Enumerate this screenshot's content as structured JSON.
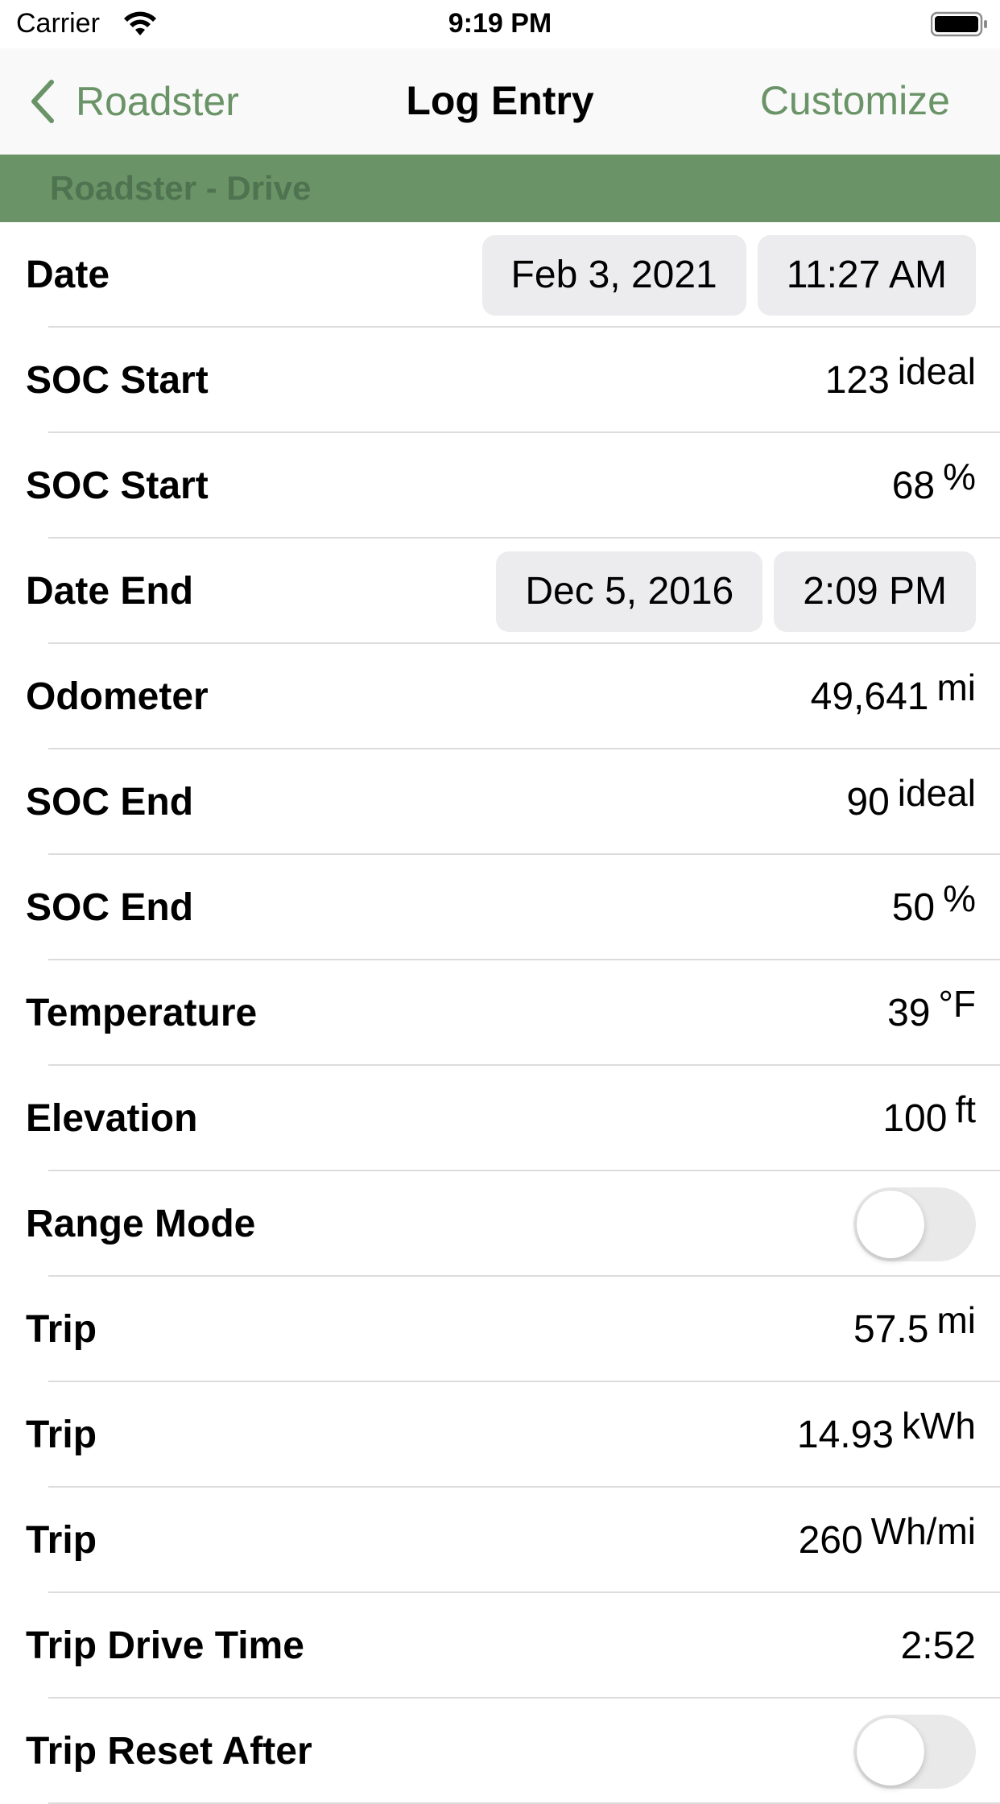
{
  "status_bar": {
    "carrier": "Carrier",
    "time": "9:19 PM",
    "icons": [
      "wifi-icon",
      "battery-icon"
    ]
  },
  "nav": {
    "back_label": "Roadster",
    "title": "Log Entry",
    "right_label": "Customize",
    "accent_color": "#6a9467"
  },
  "section": {
    "title": "Roadster - Drive",
    "color": "#6a9467"
  },
  "rows": {
    "date": {
      "label": "Date",
      "date": "Feb 3, 2021",
      "time": "11:27 AM"
    },
    "soc_start_ideal": {
      "label": "SOC Start",
      "value": "123",
      "unit": "ideal"
    },
    "soc_start_pct": {
      "label": "SOC Start",
      "value": "68",
      "unit": "%"
    },
    "date_end": {
      "label": "Date End",
      "date": "Dec 5, 2016",
      "time": "2:09 PM"
    },
    "odometer": {
      "label": "Odometer",
      "value": "49,641",
      "unit": "mi"
    },
    "soc_end_ideal": {
      "label": "SOC End",
      "value": "90",
      "unit": "ideal"
    },
    "soc_end_pct": {
      "label": "SOC End",
      "value": "50",
      "unit": "%"
    },
    "temperature": {
      "label": "Temperature",
      "value": "39",
      "unit": "°F"
    },
    "elevation": {
      "label": "Elevation",
      "value": "100",
      "unit": "ft"
    },
    "range_mode": {
      "label": "Range Mode",
      "on": false
    },
    "trip_mi": {
      "label": "Trip",
      "value": "57.5",
      "unit": "mi"
    },
    "trip_kwh": {
      "label": "Trip",
      "value": "14.93",
      "unit": "kWh"
    },
    "trip_whmi": {
      "label": "Trip",
      "value": "260",
      "unit": "Wh/mi"
    },
    "trip_drive_time": {
      "label": "Trip Drive Time",
      "value": "2:52"
    },
    "trip_reset_after": {
      "label": "Trip Reset After",
      "on": false
    }
  }
}
